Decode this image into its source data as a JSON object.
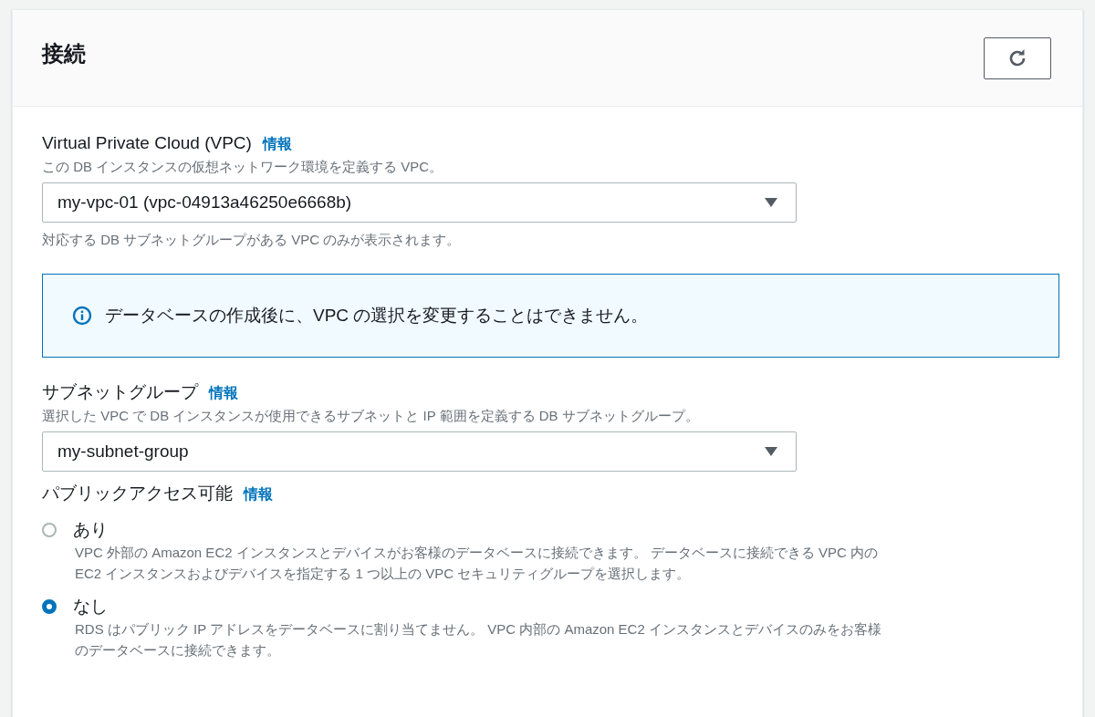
{
  "panel": {
    "title": "接続"
  },
  "vpc": {
    "label": "Virtual Private Cloud (VPC)",
    "info": "情報",
    "description": "この DB インスタンスの仮想ネットワーク環境を定義する VPC。",
    "value": "my-vpc-01 (vpc-04913a46250e6668b)",
    "hint": "対応する DB サブネットグループがある VPC のみが表示されます。"
  },
  "notice": {
    "text": "データベースの作成後に、VPC の選択を変更することはできません。"
  },
  "subnet_group": {
    "label": "サブネットグループ",
    "info": "情報",
    "description": "選択した VPC で DB インスタンスが使用できるサブネットと IP 範囲を定義する DB サブネットグループ。",
    "value": "my-subnet-group"
  },
  "public_access": {
    "label": "パブリックアクセス可能",
    "info": "情報",
    "options": [
      {
        "label": "あり",
        "selected": false,
        "description_lines": [
          "VPC 外部の Amazon EC2 インスタンスとデバイスがお客様のデータベースに接続できます。 データベースに接続できる VPC 内の",
          "EC2 インスタンスおよびデバイスを指定する 1 つ以上の VPC セキュリティグループを選択します。"
        ]
      },
      {
        "label": "なし",
        "selected": true,
        "description_lines": [
          "RDS はパブリック IP アドレスをデータベースに割り当てません。 VPC 内部の Amazon EC2 インスタンスとデバイスのみをお客様",
          "のデータベースに接続できます。"
        ]
      }
    ]
  }
}
